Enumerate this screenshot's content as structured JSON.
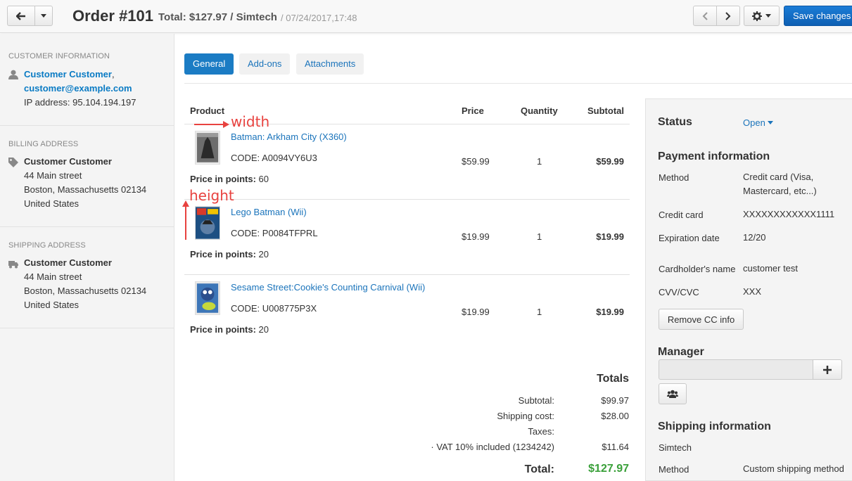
{
  "header": {
    "title": "Order #101",
    "total": "Total: $127.97 / Simtech",
    "date": "/ 07/24/2017,17:48",
    "save_label": "Save changes"
  },
  "sidebar": {
    "customer": {
      "heading": "CUSTOMER INFORMATION",
      "name": "Customer Customer",
      "comma": ",",
      "email": "customer@example.com",
      "ip": "IP address: 95.104.194.197"
    },
    "billing": {
      "heading": "BILLING ADDRESS",
      "name": "Customer Customer",
      "street": "44 Main street",
      "city": "Boston, Massachusetts 02134",
      "country": "United States"
    },
    "shipping": {
      "heading": "SHIPPING ADDRESS",
      "name": "Customer Customer",
      "street": "44 Main street",
      "city": "Boston, Massachusetts 02134",
      "country": "United States"
    }
  },
  "tabs": [
    {
      "label": "General"
    },
    {
      "label": "Add-ons"
    },
    {
      "label": "Attachments"
    }
  ],
  "table": {
    "headers": {
      "product": "Product",
      "price": "Price",
      "quantity": "Quantity",
      "subtotal": "Subtotal"
    },
    "points_label": "Price in points:",
    "rows": [
      {
        "name": "Batman: Arkham City (X360)",
        "code": "CODE: A0094VY6U3",
        "points": "60",
        "price": "$59.99",
        "qty": "1",
        "subtotal": "$59.99"
      },
      {
        "name": "Lego Batman (Wii)",
        "code": "CODE: P0084TFPRL",
        "points": "20",
        "price": "$19.99",
        "qty": "1",
        "subtotal": "$19.99"
      },
      {
        "name": "Sesame Street:Cookie's Counting Carnival (Wii)",
        "code": "CODE: U008775P3X",
        "points": "20",
        "price": "$19.99",
        "qty": "1",
        "subtotal": "$19.99"
      }
    ]
  },
  "annotations": {
    "width": "width",
    "height": "height"
  },
  "totals": {
    "title": "Totals",
    "subtotal_label": "Subtotal:",
    "subtotal": "$99.97",
    "shipping_label": "Shipping cost:",
    "shipping": "$28.00",
    "taxes_label": "Taxes:",
    "vat_label": "· VAT 10% included (1234242)",
    "vat": "$11.64",
    "total_label": "Total:",
    "total": "$127.97"
  },
  "panel": {
    "status_heading": "Status",
    "status_value": "Open",
    "payment_heading": "Payment information",
    "method_label": "Method",
    "method_value_1": "Credit card (Visa,",
    "method_value_2": "Mastercard, etc...)",
    "cc_label": "Credit card",
    "cc_value": "XXXXXXXXXXXX1111",
    "exp_label": "Expiration date",
    "exp_value": "12/20",
    "holder_label": "Cardholder's name",
    "holder_value": "customer test",
    "cvv_label": "CVV/CVC",
    "cvv_value": "XXX",
    "remove_label": "Remove CC info",
    "manager_heading": "Manager",
    "shipping_heading": "Shipping information",
    "shipping_company": "Simtech",
    "ship_method_label": "Method",
    "ship_method_value": "Custom shipping method"
  }
}
